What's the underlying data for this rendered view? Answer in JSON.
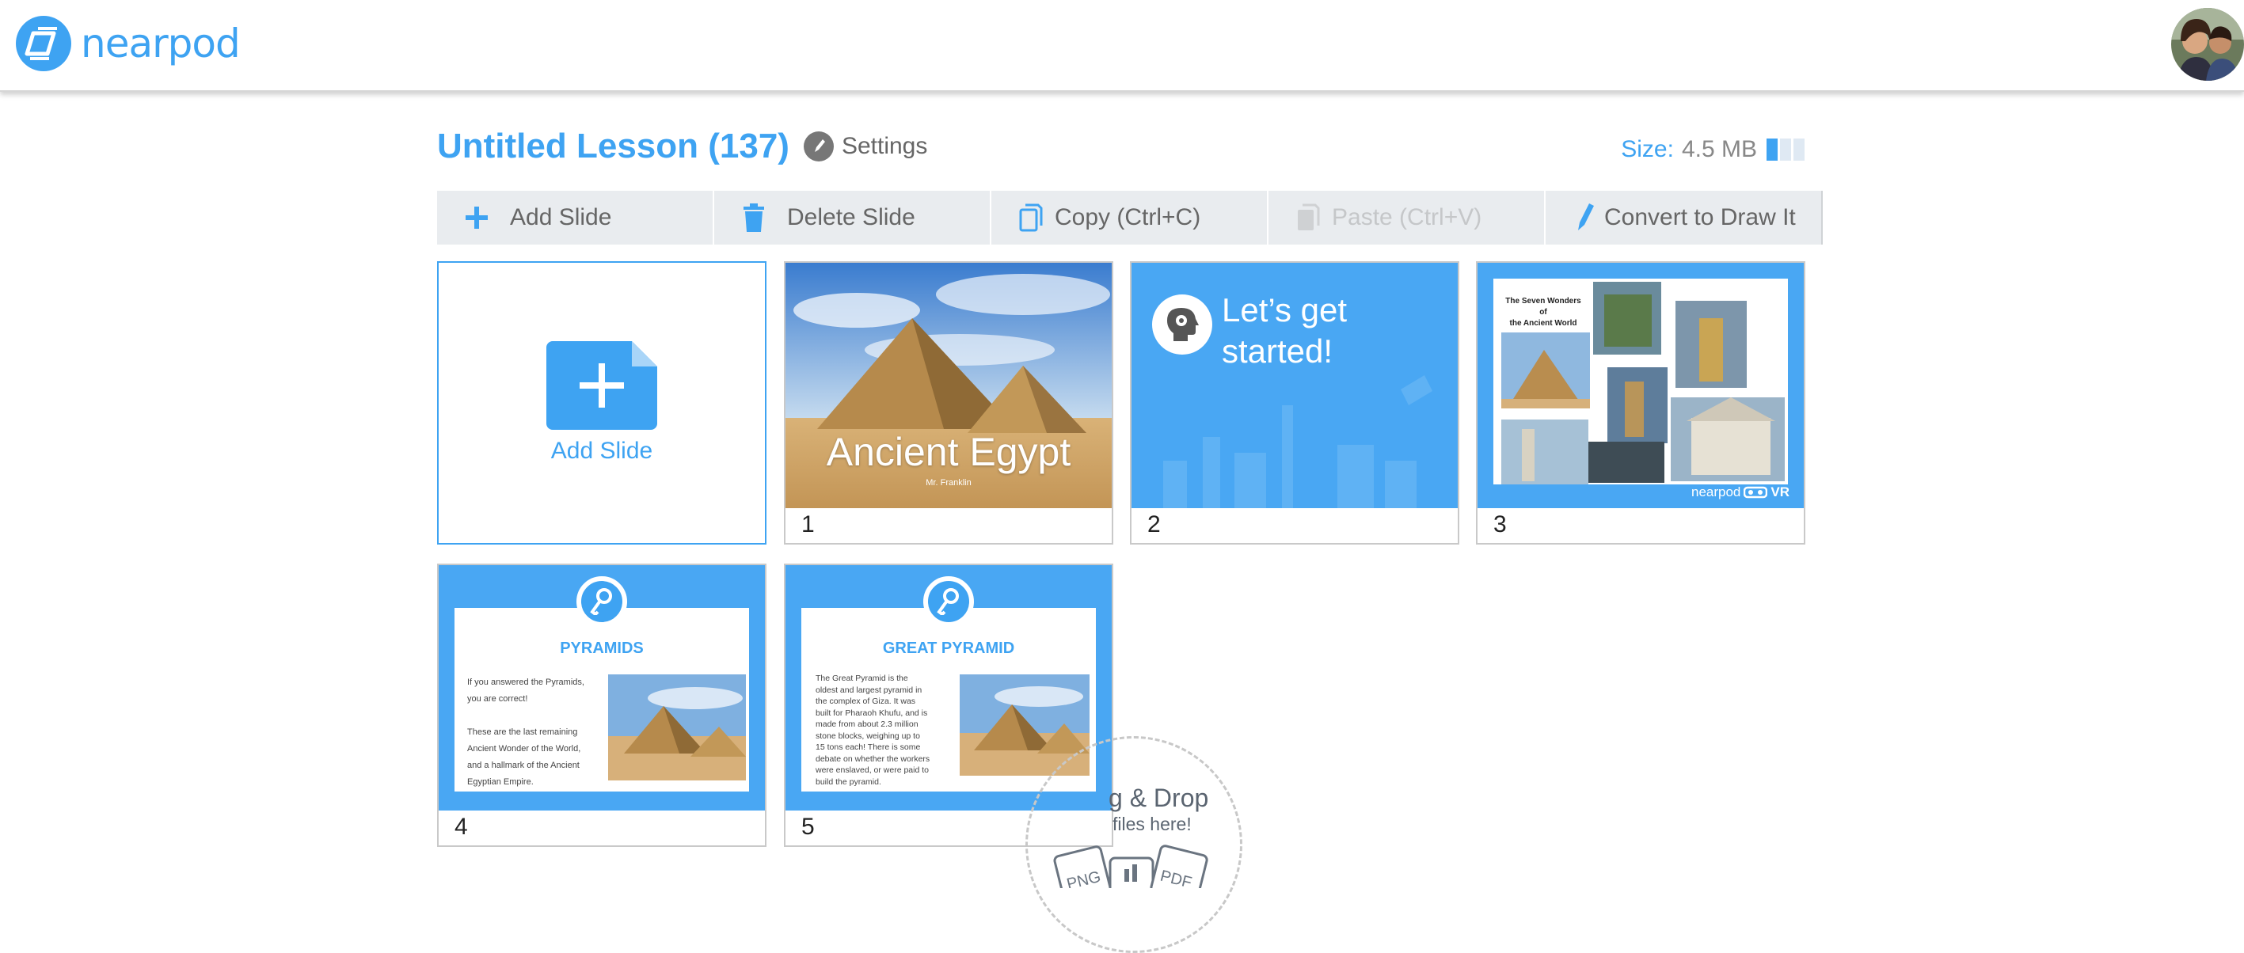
{
  "header": {
    "brand": "nearpod"
  },
  "lesson": {
    "title": "Untitled Lesson (137)",
    "settings_label": "Settings",
    "size_label": "Size:",
    "size_value": "4.5 MB"
  },
  "toolbar": {
    "add_slide": "Add Slide",
    "delete_slide": "Delete Slide",
    "copy": "Copy (Ctrl+C)",
    "paste": "Paste (Ctrl+V)",
    "convert": "Convert to Draw It"
  },
  "add_tile": {
    "label": "Add Slide"
  },
  "slides": [
    {
      "number": "1",
      "title": "Ancient Egypt",
      "subtitle": "Mr. Franklin"
    },
    {
      "number": "2",
      "title_line1": "Let’s get",
      "title_line2": "started!"
    },
    {
      "number": "3",
      "title_line1": "The Seven Wonders of",
      "title_line2": "the Ancient World",
      "brand": "nearpod",
      "brand_suffix": "VR"
    },
    {
      "number": "4",
      "heading": "PYRAMIDS",
      "body": [
        "If you answered the Pyramids,",
        "you are correct!",
        "",
        "These are the last remaining",
        "Ancient Wonder of the World,",
        "and a hallmark of the Ancient",
        "Egyptian Empire."
      ]
    },
    {
      "number": "5",
      "heading": "GREAT PYRAMID",
      "body": [
        "The Great Pyramid is the",
        "oldest and largest pyramid in",
        "the complex of Giza. It was",
        "built for Pharaoh Khufu, and is",
        "made from about 2.3 million",
        "stone blocks, weighing up to",
        "15 tons each! There is some",
        "debate on whether the workers",
        "were enslaved, or were paid to",
        "build the pyramid."
      ]
    }
  ],
  "dropzone": {
    "title": "g & Drop",
    "subtitle": "files here!",
    "icons": [
      "PNG",
      "PDF"
    ]
  },
  "colors": {
    "accent": "#3ea3f2",
    "toolbar_bg": "#e9ecef"
  }
}
